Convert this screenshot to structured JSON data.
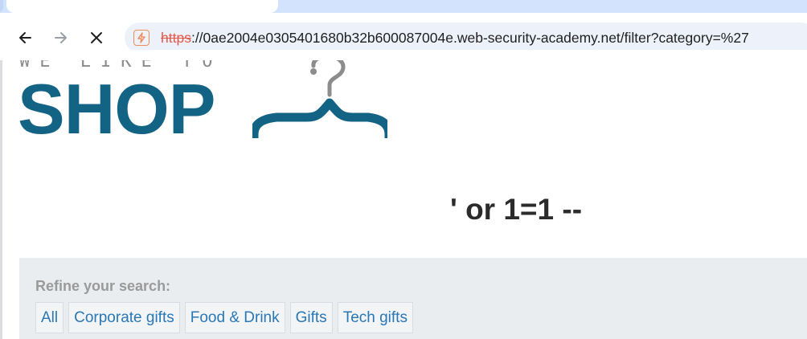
{
  "browser": {
    "url_scheme": "https",
    "url_rest": "://0ae2004e0305401680b32b600087004e.web-security-academy.net/filter?category=%27",
    "security_icon": "not-secure-icon",
    "nav_icons": [
      "back-arrow-icon",
      "forward-arrow-icon",
      "stop-loading-icon"
    ]
  },
  "logo": {
    "tagline": "WE LIKE TO",
    "wordmark": "SHOP",
    "icon": "coat-hanger-icon",
    "colors": {
      "wordmark": "#136384",
      "tagline": "#8c8c8c"
    }
  },
  "main": {
    "heading": "' or 1=1 --"
  },
  "filters": {
    "title": "Refine your search:",
    "links": [
      "All",
      "Corporate gifts",
      "Food & Drink",
      "Gifts",
      "Tech gifts"
    ]
  }
}
